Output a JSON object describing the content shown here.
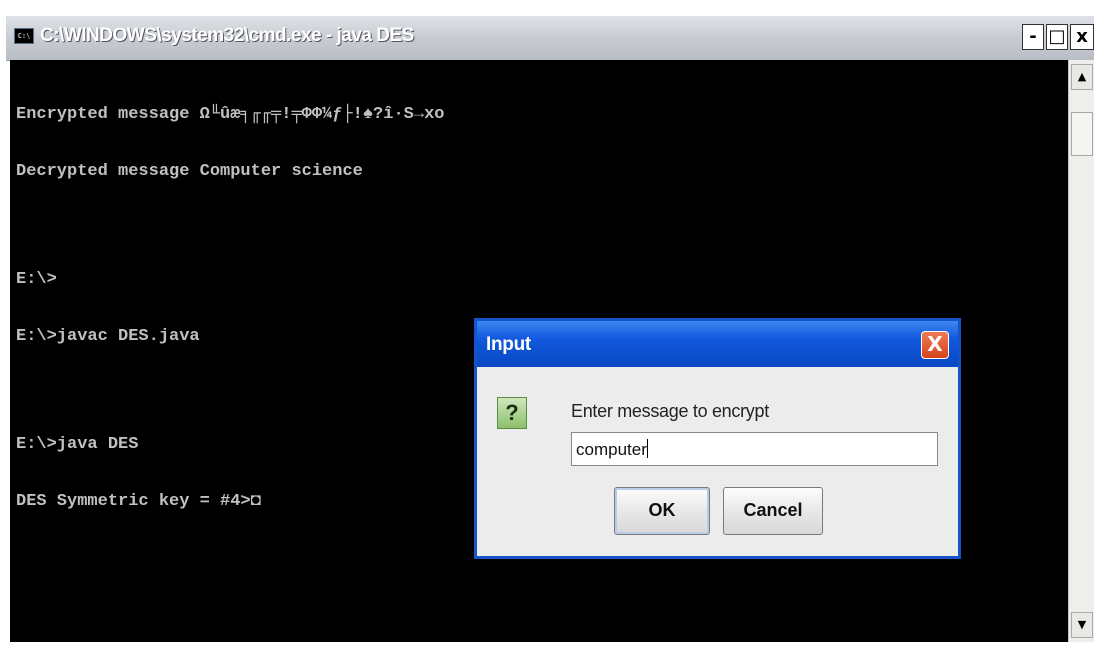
{
  "window": {
    "title": "C:\\WINDOWS\\system32\\cmd.exe - java DES",
    "icon_label": "C:\\",
    "minimize_label": "-",
    "maximize_label": "□",
    "close_label": "x"
  },
  "console": {
    "lines": [
      "Encrypted message Ω╙ûæ╕╓╓╤!╤ΦΦ¼ƒ├!♠?î·S→xo",
      "Decrypted message Computer science",
      "",
      "E:\\>",
      "E:\\>javac DES.java",
      "",
      "E:\\>java DES",
      "DES Symmetric key = #4>◘"
    ]
  },
  "scrollbar": {
    "up_arrow": "▲",
    "down_arrow": "▼"
  },
  "dialog": {
    "title": "Input",
    "close_label": "X",
    "icon_glyph": "?",
    "prompt": "Enter message to encrypt",
    "input_value": "computer",
    "ok_label": "OK",
    "cancel_label": "Cancel"
  }
}
